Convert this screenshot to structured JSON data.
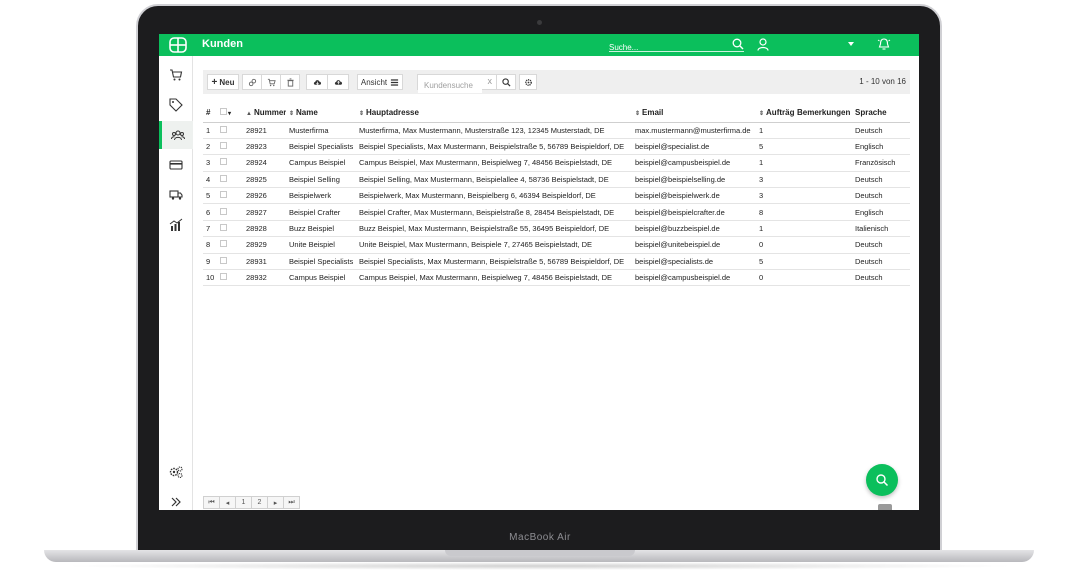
{
  "header": {
    "title": "Kunden",
    "search_placeholder": "Suche...",
    "accent_color": "#0bbf5c"
  },
  "device_label": "MacBook Air",
  "sidebar": {
    "items": [
      {
        "icon": "cart-icon"
      },
      {
        "icon": "tags-icon"
      },
      {
        "icon": "customers-icon",
        "active": true
      },
      {
        "icon": "credit-card-icon"
      },
      {
        "icon": "truck-icon"
      },
      {
        "icon": "analytics-icon"
      }
    ],
    "bottom": [
      {
        "icon": "settings-icon"
      },
      {
        "icon": "expand-icon"
      }
    ]
  },
  "toolbar": {
    "new_label": "Neu",
    "view_label": "Ansicht",
    "search_placeholder": "Kundensuche",
    "clear_glyph": "x",
    "page_info": "1 - 10 von 16"
  },
  "table": {
    "columns": [
      "#",
      "",
      "Nummer",
      "Name",
      "Hauptadresse",
      "Email",
      "Aufträge",
      "Bemerkungen",
      "Sprache"
    ],
    "rows": [
      [
        "1",
        "28921",
        "Musterfirma",
        "Musterfirma, Max Mustermann, Musterstraße 123, 12345 Musterstadt, DE",
        "max.mustermann@musterfirma.de",
        "1",
        "",
        "Deutsch"
      ],
      [
        "2",
        "28923",
        "Beispiel Specialists",
        "Beispiel Specialists, Max Mustermann, Beispielstraße 5, 56789 Beispieldorf, DE",
        "beispiel@specialist.de",
        "5",
        "",
        "Englisch"
      ],
      [
        "3",
        "28924",
        "Campus Beispiel",
        "Campus Beispiel, Max Mustermann, Beispielweg 7, 48456 Beispielstadt, DE",
        "beispiel@campusbeispiel.de",
        "1",
        "",
        "Französisch"
      ],
      [
        "4",
        "28925",
        "Beispiel Selling",
        "Beispiel Selling, Max Mustermann, Beispielallee 4, 58736 Beispielstadt, DE",
        "beispiel@beispielselling.de",
        "3",
        "",
        "Deutsch"
      ],
      [
        "5",
        "28926",
        "Beispielwerk",
        "Beispielwerk, Max Mustermann, Beispielberg 6, 46394 Beispieldorf, DE",
        "beispiel@beispielwerk.de",
        "3",
        "",
        "Deutsch"
      ],
      [
        "6",
        "28927",
        "Beispiel Crafter",
        "Beispiel Crafter, Max Mustermann, Beispielstraße 8, 28454 Beispielstadt, DE",
        "beispiel@beispielcrafter.de",
        "8",
        "",
        "Englisch"
      ],
      [
        "7",
        "28928",
        "Buzz Beispiel",
        "Buzz Beispiel, Max Mustermann, Beispielstraße 55, 36495 Beispieldorf, DE",
        "beispiel@buzzbeispiel.de",
        "1",
        "",
        "Italienisch"
      ],
      [
        "8",
        "28929",
        "Unite Beispiel",
        "Unite Beispiel, Max Mustermann, Beispiele 7, 27465 Beispielstadt, DE",
        "beispiel@unitebeispiel.de",
        "0",
        "",
        "Deutsch"
      ],
      [
        "9",
        "28931",
        "Beispiel Specialists",
        "Beispiel Specialists, Max Mustermann, Beispielstraße 5, 56789 Beispieldorf, DE",
        "beispiel@specialists.de",
        "5",
        "",
        "Deutsch"
      ],
      [
        "10",
        "28932",
        "Campus Beispiel",
        "Campus Beispiel, Max Mustermann, Beispielweg 7, 48456 Beispielstadt, DE",
        "beispiel@campusbeispiel.de",
        "0",
        "",
        "Deutsch"
      ]
    ]
  },
  "pagination": {
    "first": "⏮",
    "prev": "◂",
    "pages": [
      "1",
      "2"
    ],
    "next": "▸",
    "last": "⏭"
  }
}
